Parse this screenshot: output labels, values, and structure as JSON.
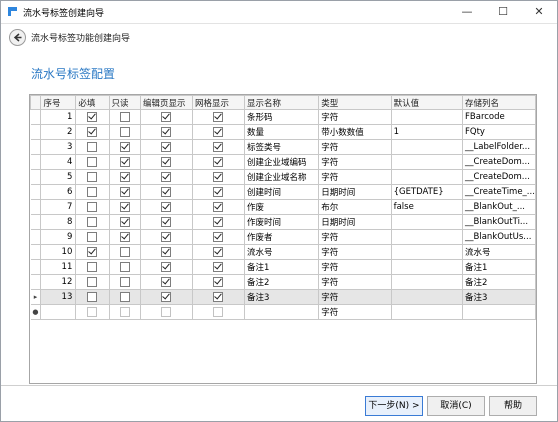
{
  "window": {
    "title": "流水号标签创建向导"
  },
  "wizard": {
    "subtitle": "流水号标签功能创建向导",
    "section_title": "流水号标签配置"
  },
  "columns": [
    "",
    "序号",
    "必填",
    "只读",
    "编辑页显示",
    "网格显示",
    "显示名称",
    "类型",
    "默认值",
    "存储列名"
  ],
  "rows": [
    {
      "marker": "",
      "seq": "1",
      "required": true,
      "readonly": false,
      "edit_show": true,
      "grid_show": true,
      "name": "条形码",
      "type": "字符",
      "default": "",
      "column": "FBarcode"
    },
    {
      "marker": "",
      "seq": "2",
      "required": true,
      "readonly": false,
      "edit_show": true,
      "grid_show": true,
      "name": "数量",
      "type": "带小数数值",
      "default": "1",
      "column": "FQty"
    },
    {
      "marker": "",
      "seq": "3",
      "required": false,
      "readonly": true,
      "edit_show": true,
      "grid_show": true,
      "name": "标签类号",
      "type": "字符",
      "default": "",
      "column": "__LabelFolder..."
    },
    {
      "marker": "",
      "seq": "4",
      "required": false,
      "readonly": true,
      "edit_show": true,
      "grid_show": true,
      "name": "创建企业域编码",
      "type": "字符",
      "default": "",
      "column": "__CreateDom..."
    },
    {
      "marker": "",
      "seq": "5",
      "required": false,
      "readonly": true,
      "edit_show": true,
      "grid_show": true,
      "name": "创建企业域名称",
      "type": "字符",
      "default": "",
      "column": "__CreateDom..."
    },
    {
      "marker": "",
      "seq": "6",
      "required": false,
      "readonly": true,
      "edit_show": true,
      "grid_show": true,
      "name": "创建时间",
      "type": "日期时间",
      "default": "{GETDATE}",
      "column": "__CreateTime_..."
    },
    {
      "marker": "",
      "seq": "7",
      "required": false,
      "readonly": true,
      "edit_show": true,
      "grid_show": true,
      "name": "作废",
      "type": "布尔",
      "default": "false",
      "column": "__BlankOut_..."
    },
    {
      "marker": "",
      "seq": "8",
      "required": false,
      "readonly": true,
      "edit_show": true,
      "grid_show": true,
      "name": "作废时间",
      "type": "日期时间",
      "default": "",
      "column": "__BlankOutTi..."
    },
    {
      "marker": "",
      "seq": "9",
      "required": false,
      "readonly": true,
      "edit_show": true,
      "grid_show": true,
      "name": "作废者",
      "type": "字符",
      "default": "",
      "column": "__BlankOutUs..."
    },
    {
      "marker": "",
      "seq": "10",
      "required": true,
      "readonly": false,
      "edit_show": true,
      "grid_show": true,
      "name": "流水号",
      "type": "字符",
      "default": "",
      "column": "流水号"
    },
    {
      "marker": "",
      "seq": "11",
      "required": false,
      "readonly": false,
      "edit_show": true,
      "grid_show": true,
      "name": "备注1",
      "type": "字符",
      "default": "",
      "column": "备注1"
    },
    {
      "marker": "",
      "seq": "12",
      "required": false,
      "readonly": false,
      "edit_show": true,
      "grid_show": true,
      "name": "备注2",
      "type": "字符",
      "default": "",
      "column": "备注2"
    },
    {
      "marker": "▸",
      "seq": "13",
      "required": false,
      "readonly": false,
      "edit_show": true,
      "grid_show": true,
      "name": "备注3",
      "type": "字符",
      "default": "",
      "column": "备注3"
    },
    {
      "marker": "●",
      "seq": "",
      "required": false,
      "readonly": false,
      "edit_show": false,
      "grid_show": false,
      "name": "",
      "type": "字符",
      "default": "",
      "column": ""
    }
  ],
  "buttons": {
    "next": "下一步(N) >",
    "cancel": "取消(C)",
    "help": "帮助"
  }
}
